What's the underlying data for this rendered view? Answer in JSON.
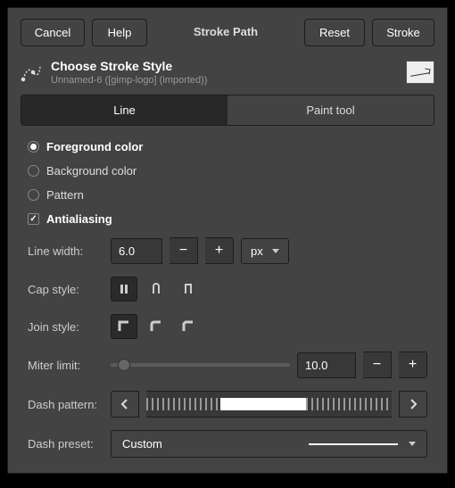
{
  "topbar": {
    "cancel": "Cancel",
    "help": "Help",
    "title": "Stroke Path",
    "reset": "Reset",
    "stroke": "Stroke"
  },
  "header": {
    "title": "Choose Stroke Style",
    "subtitle": "Unnamed-6 ([gimp-logo] (imported))"
  },
  "tabs": {
    "line": "Line",
    "paint": "Paint tool"
  },
  "options": {
    "fg": "Foreground color",
    "bg": "Background color",
    "pattern": "Pattern",
    "antialias": "Antialiasing"
  },
  "labels": {
    "line_width": "Line width:",
    "cap_style": "Cap style:",
    "join_style": "Join style:",
    "miter_limit": "Miter limit:",
    "dash_pattern": "Dash pattern:",
    "dash_preset": "Dash preset:"
  },
  "values": {
    "line_width": "6.0",
    "unit": "px",
    "miter_limit": "10.0",
    "preset": "Custom"
  }
}
